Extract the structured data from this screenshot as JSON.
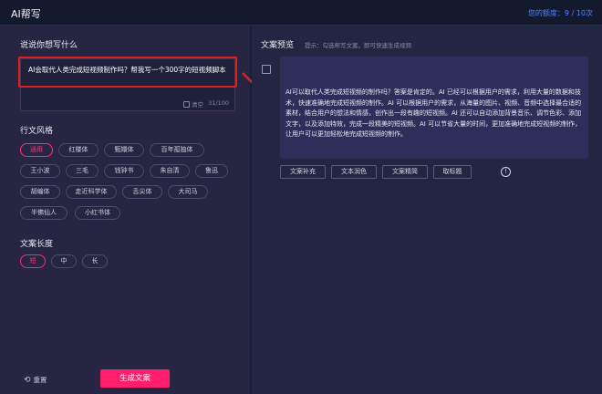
{
  "header": {
    "title": "AI帮写",
    "quota": "您的额度：9 / 10次"
  },
  "left": {
    "prompt_title": "说说你想写什么",
    "prompt_text": "AI会取代人类完成短视频制作吗？帮我写一个300字的短视频脚本",
    "clear_label": "清空",
    "char_count": "31/100",
    "style_title": "行文风格",
    "styles": [
      "通用",
      "红楼体",
      "甄嬛体",
      "百年孤独体",
      "王小波",
      "三毛",
      "钱钟书",
      "朱自清",
      "鲁迅",
      "胡编体",
      "走近科学体",
      "舌尖体",
      "大司马",
      "半佛仙人",
      "小红书体"
    ],
    "length_title": "文案长度",
    "lengths": [
      "短",
      "中",
      "长"
    ],
    "reset_label": "重置",
    "generate_label": "生成文案"
  },
  "right": {
    "preview_title": "文案预览",
    "preview_hint": "提示：勾选帮写文案，即可快速生成视频",
    "content": "AI可以取代人类完成短视频的制作吗？答案是肯定的。AI 已经可以根据用户的需求，利用大量的数据和技术，快速准确地完成短视频的制作。AI 可以根据用户的需求，从海量的图片、视频、音频中选择最合适的素材，结合用户的想法和情感，创作出一段有趣的短视频。AI 还可以自动添加背景音乐、调节色彩、添加文字，以及添加特效，完成一段精美的短视频。AI 可以节省大量的时间，更加准确地完成短视频的制作，让用户可以更加轻松地完成短视频的制作。",
    "actions": [
      "文案补充",
      "文本润色",
      "文案精简",
      "取标题"
    ]
  },
  "colors": {
    "accent": "#ff1f6b",
    "highlight": "#e02020",
    "quota_blue": "#4a83ff"
  }
}
